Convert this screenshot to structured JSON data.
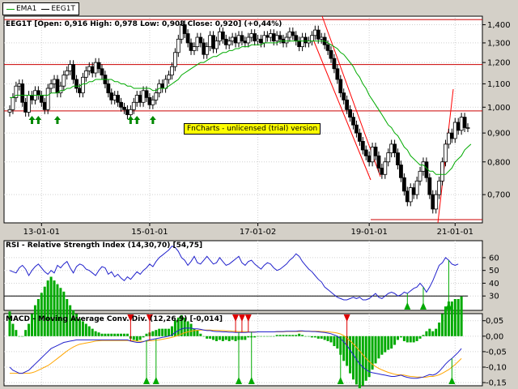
{
  "legend": {
    "ema_label": "EMA1",
    "ema_color": "#00aa00",
    "price_label": "EEG1T",
    "price_color": "#000000"
  },
  "watermark": "FnCharts - unlicensed (trial) version",
  "colors": {
    "background": "#d4d0c8",
    "plot_bg": "#ffffff",
    "grid": "#d0d0d0",
    "support": "#cc0000",
    "trend": "#ff0000",
    "rsi": "#2222cc",
    "macd": "#2222cc",
    "signal": "#ffa500",
    "hist": "#00aa00",
    "buy": "#00aa00",
    "sell": "#dd0000",
    "arrow": "#008800"
  },
  "chart_data": [
    {
      "type": "candlestick",
      "title": "EEG1T [Open: 0,916  High: 0,978  Low: 0,908  Close: 0,920] (+0,44%)",
      "x_tick_labels": [
        "13-01-01",
        "15-01-01",
        "17-01-02",
        "19-01-01",
        "21-01-01"
      ],
      "y_tick_labels": [
        "0,700",
        "0,800",
        "0,900",
        "1,000",
        "1,100",
        "1,200",
        "1,300",
        "1,400"
      ],
      "ylim": [
        0.63,
        1.44
      ],
      "y_scale": "log",
      "support_lines": [
        1.43,
        1.19,
        0.985,
        0.632
      ],
      "buy_arrows_at_bar": [
        7,
        9,
        15,
        38,
        40,
        45
      ],
      "close": [
        0.99,
        1.04,
        1.09,
        1.1,
        1.02,
        0.98,
        1.05,
        1.03,
        1.07,
        1.05,
        1.02,
        0.99,
        1.08,
        1.1,
        1.12,
        1.06,
        1.09,
        1.14,
        1.16,
        1.19,
        1.12,
        1.08,
        1.06,
        1.13,
        1.16,
        1.18,
        1.15,
        1.2,
        1.17,
        1.14,
        1.1,
        1.06,
        1.03,
        1.05,
        1.02,
        1.0,
        0.99,
        0.97,
        0.99,
        1.02,
        1.05,
        1.02,
        1.07,
        1.04,
        1.01,
        1.03,
        1.06,
        1.1,
        1.08,
        1.12,
        1.14,
        1.18,
        1.25,
        1.32,
        1.4,
        1.35,
        1.3,
        1.26,
        1.28,
        1.33,
        1.3,
        1.24,
        1.28,
        1.34,
        1.27,
        1.31,
        1.36,
        1.32,
        1.29,
        1.31,
        1.33,
        1.3,
        1.34,
        1.31,
        1.3,
        1.33,
        1.35,
        1.31,
        1.32,
        1.3,
        1.34,
        1.33,
        1.35,
        1.31,
        1.34,
        1.32,
        1.3,
        1.33,
        1.36,
        1.34,
        1.31,
        1.28,
        1.33,
        1.3,
        1.31,
        1.34,
        1.37,
        1.32,
        1.33,
        1.29,
        1.26,
        1.22,
        1.17,
        1.12,
        1.06,
        1.03,
        0.99,
        0.96,
        0.93,
        0.9,
        0.87,
        0.84,
        0.82,
        0.8,
        0.85,
        0.82,
        0.78,
        0.76,
        0.8,
        0.83,
        0.86,
        0.83,
        0.79,
        0.75,
        0.71,
        0.68,
        0.72,
        0.7,
        0.74,
        0.77,
        0.8,
        0.75,
        0.7,
        0.66,
        0.7,
        0.74,
        0.8,
        0.86,
        0.9,
        0.88,
        0.94,
        0.91,
        0.96,
        0.92,
        0.92
      ],
      "ema": [
        1.04,
        1.04,
        1.05,
        1.05,
        1.05,
        1.05,
        1.05,
        1.05,
        1.05,
        1.05,
        1.05,
        1.05,
        1.05,
        1.06,
        1.06,
        1.06,
        1.07,
        1.07,
        1.08,
        1.08,
        1.09,
        1.09,
        1.09,
        1.1,
        1.1,
        1.11,
        1.11,
        1.12,
        1.12,
        1.12,
        1.12,
        1.12,
        1.12,
        1.11,
        1.11,
        1.1,
        1.1,
        1.09,
        1.09,
        1.08,
        1.08,
        1.08,
        1.08,
        1.08,
        1.08,
        1.07,
        1.07,
        1.08,
        1.08,
        1.08,
        1.09,
        1.1,
        1.11,
        1.12,
        1.14,
        1.15,
        1.16,
        1.17,
        1.18,
        1.19,
        1.2,
        1.2,
        1.21,
        1.22,
        1.23,
        1.23,
        1.24,
        1.25,
        1.25,
        1.26,
        1.26,
        1.27,
        1.27,
        1.28,
        1.28,
        1.28,
        1.29,
        1.29,
        1.29,
        1.29,
        1.3,
        1.3,
        1.3,
        1.3,
        1.3,
        1.31,
        1.31,
        1.31,
        1.31,
        1.31,
        1.31,
        1.31,
        1.31,
        1.31,
        1.31,
        1.31,
        1.31,
        1.31,
        1.31,
        1.31,
        1.3,
        1.29,
        1.28,
        1.27,
        1.25,
        1.24,
        1.22,
        1.2,
        1.18,
        1.15,
        1.13,
        1.1,
        1.08,
        1.05,
        1.03,
        1.01,
        0.99,
        0.97,
        0.95,
        0.93,
        0.92,
        0.9,
        0.89,
        0.87,
        0.85,
        0.84,
        0.82,
        0.81,
        0.8,
        0.79,
        0.79,
        0.78,
        0.77,
        0.77,
        0.76,
        0.76,
        0.76,
        0.76,
        0.77,
        0.78,
        0.8,
        0.81,
        0.82,
        0.84,
        0.85,
        0.86
      ]
    },
    {
      "type": "line",
      "title": "RSI - Relative Strength Index (14,30,70) [54,75]",
      "y_tick_labels": [
        "30",
        "40",
        "50",
        "60"
      ],
      "ylim": [
        20,
        72
      ],
      "threshold": 30,
      "buy_arrows_at_bar": [
        125,
        130,
        138
      ],
      "values": [
        50,
        49,
        48,
        52,
        54,
        51,
        46,
        50,
        53,
        55,
        52,
        49,
        47,
        50,
        48,
        54,
        52,
        55,
        57,
        52,
        48,
        53,
        55,
        54,
        51,
        50,
        48,
        46,
        50,
        53,
        52,
        47,
        49,
        45,
        47,
        44,
        42,
        45,
        43,
        46,
        49,
        47,
        50,
        52,
        55,
        53,
        57,
        60,
        62,
        64,
        66,
        69,
        68,
        65,
        60,
        58,
        54,
        57,
        61,
        56,
        55,
        58,
        61,
        58,
        55,
        56,
        60,
        57,
        54,
        55,
        57,
        59,
        61,
        56,
        54,
        57,
        58,
        55,
        53,
        51,
        54,
        56,
        55,
        52,
        50,
        51,
        53,
        55,
        58,
        60,
        63,
        61,
        57,
        54,
        51,
        49,
        46,
        43,
        41,
        37,
        35,
        33,
        31,
        29,
        28,
        27,
        27,
        28,
        29,
        28,
        29,
        27,
        27,
        28,
        30,
        32,
        29,
        28,
        30,
        32,
        33,
        32,
        30,
        31,
        33,
        32,
        34,
        36,
        37,
        40,
        37,
        33,
        37,
        42,
        48,
        54,
        56,
        60,
        58,
        55,
        54,
        55
      ]
    },
    {
      "type": "bar+line",
      "title": "MACD - Moving Average Conv. Div. (12,26,9) [-0,014]",
      "y_tick_labels": [
        "0,05",
        "0,00",
        "-0,05",
        "-0,10",
        "-0,15"
      ],
      "ylim": [
        -0.155,
        0.065
      ],
      "sell_signals_at_bar": [
        38,
        44,
        71,
        73,
        75,
        106
      ],
      "buy_signals_at_bar": [
        43,
        46,
        72,
        76,
        104,
        139
      ],
      "macd": [
        -0.1,
        -0.11,
        -0.115,
        -0.12,
        -0.12,
        -0.115,
        -0.11,
        -0.1,
        -0.09,
        -0.08,
        -0.07,
        -0.06,
        -0.05,
        -0.04,
        -0.035,
        -0.03,
        -0.025,
        -0.02,
        -0.018,
        -0.016,
        -0.014,
        -0.012,
        -0.012,
        -0.012,
        -0.012,
        -0.012,
        -0.012,
        -0.012,
        -0.012,
        -0.012,
        -0.012,
        -0.012,
        -0.012,
        -0.012,
        -0.012,
        -0.012,
        -0.012,
        -0.012,
        -0.016,
        -0.018,
        -0.02,
        -0.02,
        -0.018,
        -0.014,
        -0.012,
        -0.01,
        -0.008,
        -0.006,
        -0.004,
        -0.002,
        0.0,
        0.004,
        0.012,
        0.018,
        0.024,
        0.026,
        0.026,
        0.026,
        0.024,
        0.024,
        0.022,
        0.02,
        0.018,
        0.018,
        0.016,
        0.015,
        0.015,
        0.014,
        0.014,
        0.013,
        0.013,
        0.012,
        0.012,
        0.012,
        0.012,
        0.013,
        0.013,
        0.013,
        0.014,
        0.014,
        0.014,
        0.014,
        0.014,
        0.014,
        0.015,
        0.015,
        0.015,
        0.016,
        0.016,
        0.016,
        0.016,
        0.017,
        0.017,
        0.016,
        0.016,
        0.015,
        0.015,
        0.014,
        0.013,
        0.012,
        0.01,
        0.008,
        0.004,
        0.0,
        -0.008,
        -0.018,
        -0.03,
        -0.045,
        -0.06,
        -0.075,
        -0.09,
        -0.1,
        -0.108,
        -0.115,
        -0.118,
        -0.12,
        -0.122,
        -0.124,
        -0.126,
        -0.128,
        -0.13,
        -0.13,
        -0.128,
        -0.126,
        -0.13,
        -0.133,
        -0.135,
        -0.136,
        -0.136,
        -0.134,
        -0.132,
        -0.128,
        -0.124,
        -0.126,
        -0.122,
        -0.114,
        -0.102,
        -0.09,
        -0.08,
        -0.072,
        -0.062,
        -0.052,
        -0.04
      ],
      "signal": [
        -0.12,
        -0.12,
        -0.12,
        -0.12,
        -0.12,
        -0.12,
        -0.12,
        -0.118,
        -0.115,
        -0.11,
        -0.105,
        -0.1,
        -0.095,
        -0.088,
        -0.08,
        -0.072,
        -0.064,
        -0.056,
        -0.048,
        -0.041,
        -0.035,
        -0.03,
        -0.026,
        -0.024,
        -0.022,
        -0.02,
        -0.018,
        -0.016,
        -0.015,
        -0.014,
        -0.014,
        -0.014,
        -0.014,
        -0.014,
        -0.014,
        -0.014,
        -0.014,
        -0.014,
        -0.014,
        -0.015,
        -0.016,
        -0.017,
        -0.017,
        -0.016,
        -0.015,
        -0.014,
        -0.013,
        -0.012,
        -0.01,
        -0.008,
        -0.006,
        -0.004,
        -0.001,
        0.003,
        0.007,
        0.011,
        0.014,
        0.016,
        0.018,
        0.019,
        0.02,
        0.02,
        0.02,
        0.02,
        0.019,
        0.019,
        0.018,
        0.018,
        0.017,
        0.017,
        0.016,
        0.016,
        0.015,
        0.015,
        0.015,
        0.014,
        0.014,
        0.014,
        0.014,
        0.014,
        0.014,
        0.014,
        0.014,
        0.014,
        0.014,
        0.014,
        0.014,
        0.015,
        0.015,
        0.015,
        0.015,
        0.015,
        0.016,
        0.016,
        0.016,
        0.016,
        0.016,
        0.016,
        0.015,
        0.015,
        0.014,
        0.013,
        0.012,
        0.01,
        0.007,
        0.002,
        -0.006,
        -0.015,
        -0.025,
        -0.036,
        -0.048,
        -0.06,
        -0.072,
        -0.082,
        -0.091,
        -0.098,
        -0.104,
        -0.109,
        -0.113,
        -0.117,
        -0.12,
        -0.123,
        -0.125,
        -0.125,
        -0.126,
        -0.128,
        -0.13,
        -0.131,
        -0.132,
        -0.132,
        -0.133,
        -0.132,
        -0.13,
        -0.13,
        -0.128,
        -0.125,
        -0.12,
        -0.114,
        -0.108,
        -0.1,
        -0.092,
        -0.082,
        -0.072
      ]
    }
  ]
}
